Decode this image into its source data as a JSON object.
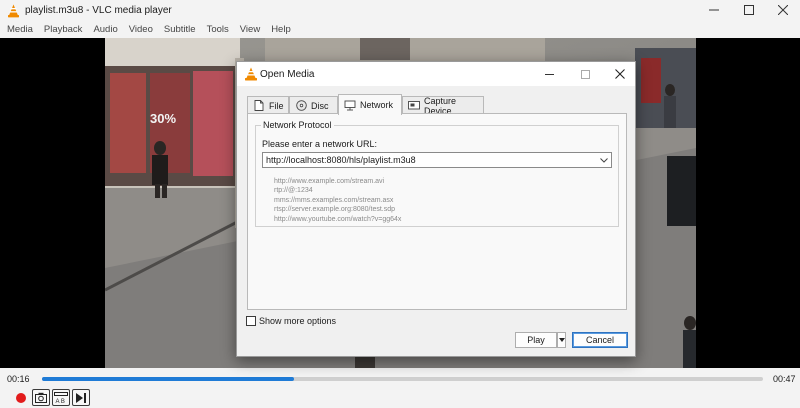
{
  "window": {
    "title": "playlist.m3u8 - VLC media player"
  },
  "menubar": {
    "items": [
      "Media",
      "Playback",
      "Audio",
      "Video",
      "Subtitle",
      "Tools",
      "View",
      "Help"
    ]
  },
  "player": {
    "time_elapsed": "00:16",
    "time_total": "00:47",
    "progress_fraction": 0.35,
    "accent_color": "#1f7bd6",
    "record_color": "#e21b1b"
  },
  "dialog": {
    "title": "Open Media",
    "tabs": [
      {
        "label": "File",
        "icon": "file-icon"
      },
      {
        "label": "Disc",
        "icon": "disc-icon"
      },
      {
        "label": "Network",
        "icon": "network-icon",
        "active": true
      },
      {
        "label": "Capture Device",
        "icon": "capture-device-icon"
      }
    ],
    "group_title": "Network Protocol",
    "url_label": "Please enter a network URL:",
    "url_value": "http://localhost:8080/hls/playlist.m3u8",
    "examples": [
      "http://www.example.com/stream.avi",
      "rtp://@:1234",
      "mms://mms.examples.com/stream.asx",
      "rtsp://server.example.org:8080/test.sdp",
      "http://www.yourtube.com/watch?v=gg64x"
    ],
    "show_more_label": "Show more options",
    "play_label": "Play",
    "cancel_label": "Cancel"
  }
}
